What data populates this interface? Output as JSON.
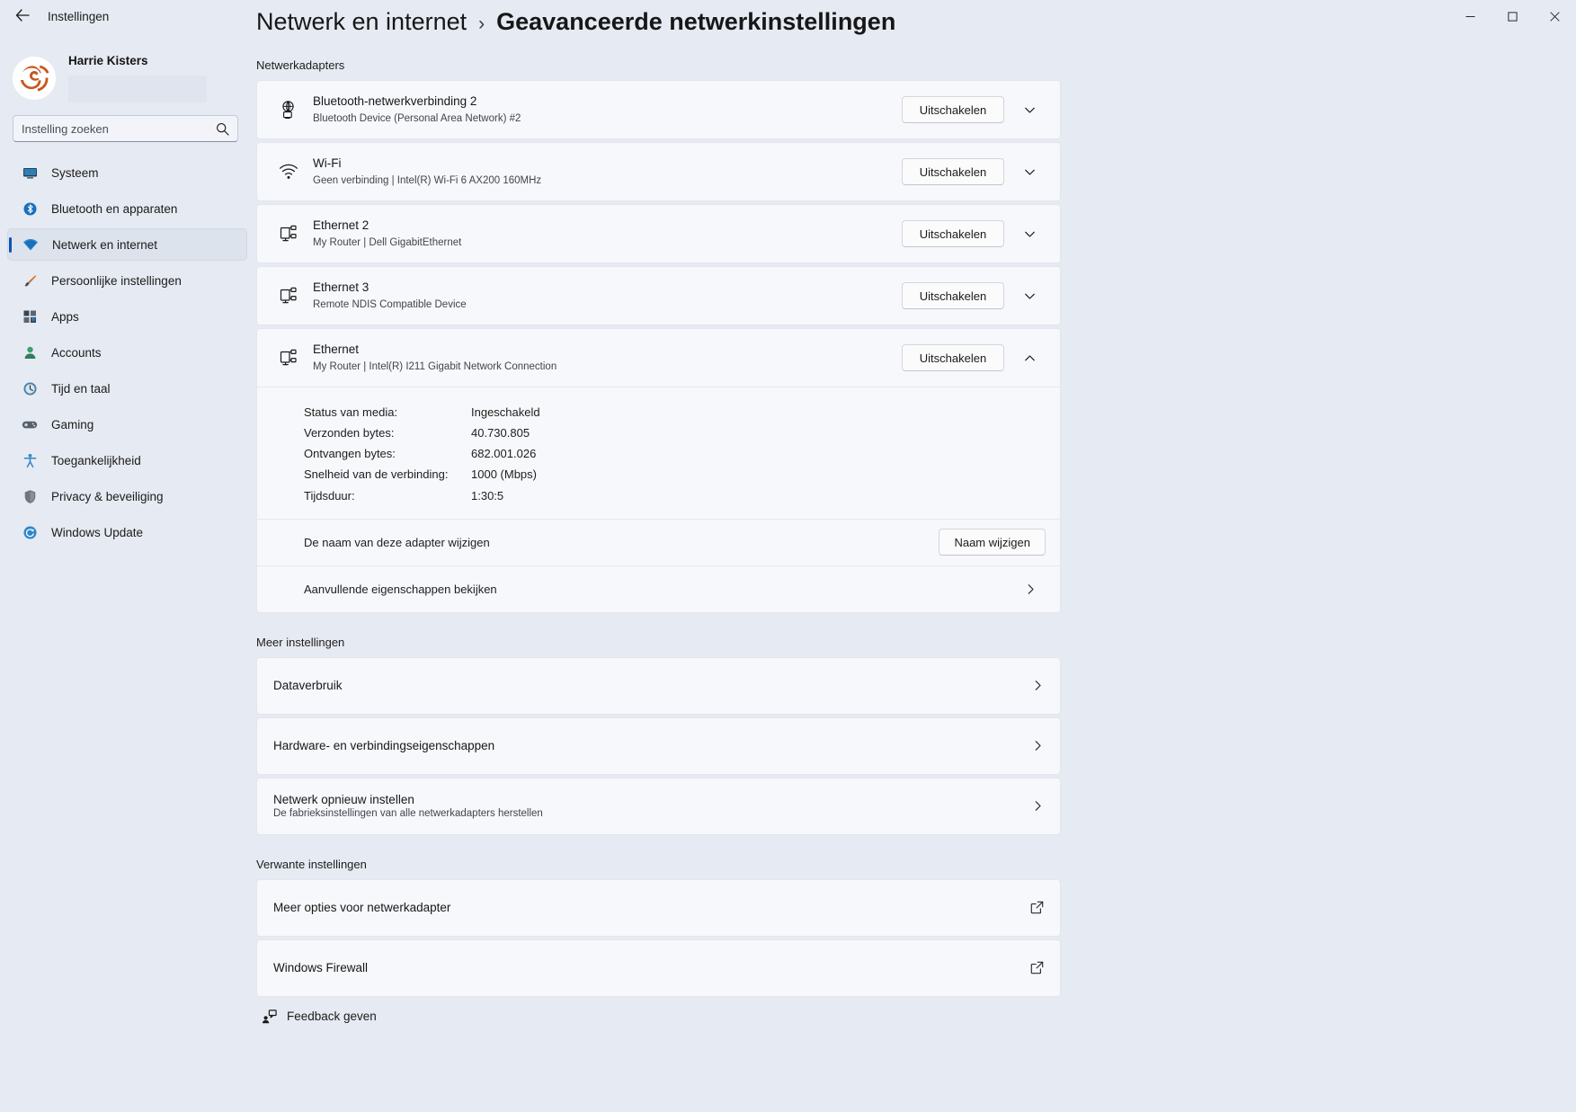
{
  "window": {
    "app_title": "Instellingen",
    "back_label": "←",
    "minimize_label": "Minimaliseren",
    "maximize_label": "Maximaliseren",
    "close_label": "Sluiten"
  },
  "sidebar": {
    "profile": {
      "name": "Harrie Kisters"
    },
    "search": {
      "placeholder": "Instelling zoeken",
      "value": ""
    },
    "items": [
      {
        "label": "Systeem",
        "icon": "monitor-icon",
        "active": false
      },
      {
        "label": "Bluetooth en apparaten",
        "icon": "bluetooth-icon",
        "active": false
      },
      {
        "label": "Netwerk en internet",
        "icon": "network-icon",
        "active": true
      },
      {
        "label": "Persoonlijke instellingen",
        "icon": "brush-icon",
        "active": false
      },
      {
        "label": "Apps",
        "icon": "apps-icon",
        "active": false
      },
      {
        "label": "Accounts",
        "icon": "person-icon",
        "active": false
      },
      {
        "label": "Tijd en taal",
        "icon": "clock-icon",
        "active": false
      },
      {
        "label": "Gaming",
        "icon": "gamepad-icon",
        "active": false
      },
      {
        "label": "Toegankelijkheid",
        "icon": "accessibility-icon",
        "active": false
      },
      {
        "label": "Privacy & beveiliging",
        "icon": "shield-icon",
        "active": false
      },
      {
        "label": "Windows Update",
        "icon": "update-icon",
        "active": false
      }
    ]
  },
  "breadcrumb": {
    "parent": "Netwerk en internet",
    "separator": "›",
    "current": "Geavanceerde netwerkinstellingen"
  },
  "sections": {
    "adapters_title": "Netwerkadapters",
    "more_settings_title": "Meer instellingen",
    "related_settings_title": "Verwante instellingen"
  },
  "adapters": [
    {
      "name": "Bluetooth-netwerkverbinding 2",
      "sub": "Bluetooth Device (Personal Area Network) #2",
      "icon": "bluetooth-network-icon",
      "button": "Uitschakelen",
      "expanded": false
    },
    {
      "name": "Wi-Fi",
      "sub": "Geen verbinding | Intel(R) Wi-Fi 6 AX200 160MHz",
      "icon": "wifi-icon",
      "button": "Uitschakelen",
      "expanded": false
    },
    {
      "name": "Ethernet 2",
      "sub": "My Router | Dell GigabitEthernet",
      "icon": "ethernet-icon",
      "button": "Uitschakelen",
      "expanded": false
    },
    {
      "name": "Ethernet 3",
      "sub": "Remote NDIS Compatible Device",
      "icon": "ethernet-icon",
      "button": "Uitschakelen",
      "expanded": false
    },
    {
      "name": "Ethernet",
      "sub": "My Router | Intel(R) I211 Gigabit Network Connection",
      "icon": "ethernet-icon",
      "button": "Uitschakelen",
      "expanded": true
    }
  ],
  "expanded_adapter_details": [
    {
      "key": "Status van media:",
      "value": "Ingeschakeld"
    },
    {
      "key": "Verzonden bytes:",
      "value": "40.730.805"
    },
    {
      "key": "Ontvangen bytes:",
      "value": "682.001.026"
    },
    {
      "key": "Snelheid van de verbinding:",
      "value": "1000 (Mbps)"
    },
    {
      "key": "Tijdsduur:",
      "value": "1:30:5"
    }
  ],
  "expanded_adapter_actions": {
    "rename_label": "De naam van deze adapter wijzigen",
    "rename_button": "Naam wijzigen",
    "more_properties_label": "Aanvullende eigenschappen bekijken"
  },
  "more_settings": [
    {
      "title": "Dataverbruik",
      "sub": "",
      "trailing": "chevron-right-icon"
    },
    {
      "title": "Hardware- en verbindingseigenschappen",
      "sub": "",
      "trailing": "chevron-right-icon"
    },
    {
      "title": "Netwerk opnieuw instellen",
      "sub": "De fabrieksinstellingen van alle netwerkadapters herstellen",
      "trailing": "chevron-right-icon"
    }
  ],
  "related_settings": [
    {
      "title": "Meer opties voor netwerkadapter",
      "sub": "",
      "trailing": "external-link-icon"
    },
    {
      "title": "Windows Firewall",
      "sub": "",
      "trailing": "external-link-icon"
    }
  ],
  "footer": {
    "feedback_label": "Feedback geven"
  },
  "colors": {
    "background": "#e6eaf2",
    "card": "#f7f8fb",
    "accent": "#0d53b5",
    "text": "#1b1b1b"
  }
}
